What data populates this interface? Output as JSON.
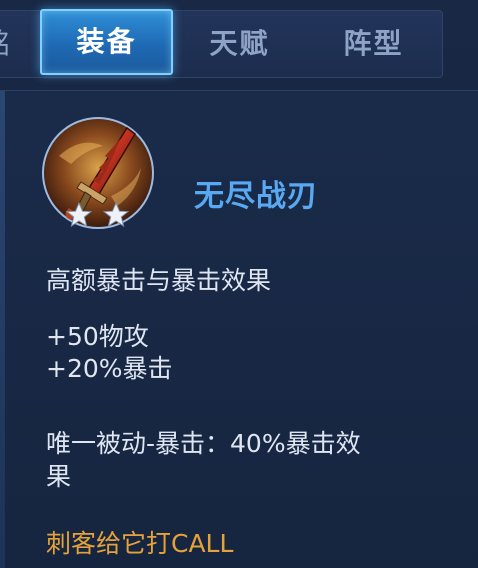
{
  "tabs": {
    "partial_label": "铭文",
    "items": [
      {
        "label": "装备",
        "active": true
      },
      {
        "label": "天赋",
        "active": false
      },
      {
        "label": "阵型",
        "active": false
      }
    ]
  },
  "item": {
    "name": "无尽战刃",
    "stars": 2,
    "icon": "sword-icon",
    "summary": "高额暴击与暴击效果",
    "stats": [
      "+50物攻",
      "+20%暴击"
    ],
    "passive_line1": "唯一被动-暴击：40%暴击效",
    "passive_line2": "果",
    "tip": "刺客给它打CALL"
  },
  "colors": {
    "accent": "#58a9f2",
    "tip": "#e6a23a",
    "text": "#dfe6f2",
    "tab_active": "#2f8fd8"
  }
}
